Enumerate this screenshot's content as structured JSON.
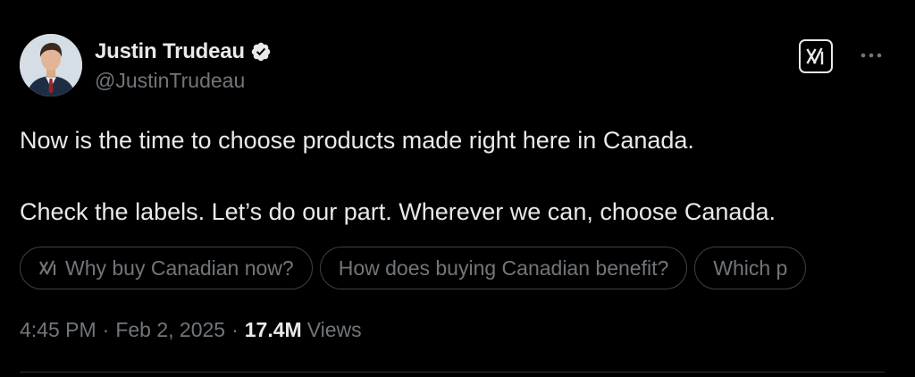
{
  "author": {
    "display_name": "Justin Trudeau",
    "handle": "@JustinTrudeau",
    "verified": true,
    "verified_color": "#e7e9ea",
    "avatar_icon": "profile-photo"
  },
  "header_actions": {
    "grok_icon": "grok-icon",
    "more_icon": "more-options-icon"
  },
  "tweet": {
    "line_1": "Now is the time to choose products made right here in Canada.",
    "line_2": "Check the labels. Let’s do our part. Wherever we can, choose Canada."
  },
  "grok_suggestions": [
    {
      "label": "Why buy Canadian now?",
      "has_icon": true
    },
    {
      "label": "How does buying Canadian benefit?",
      "has_icon": false
    },
    {
      "label": "Which p",
      "has_icon": false
    }
  ],
  "meta": {
    "time": "4:45 PM",
    "separator": "·",
    "date": "Feb 2, 2025",
    "views_count": "17.4M",
    "views_label": "Views"
  },
  "colors": {
    "background": "#000000",
    "primary_text": "#e7e9ea",
    "secondary_text": "#71767b",
    "border": "#3e4144"
  }
}
